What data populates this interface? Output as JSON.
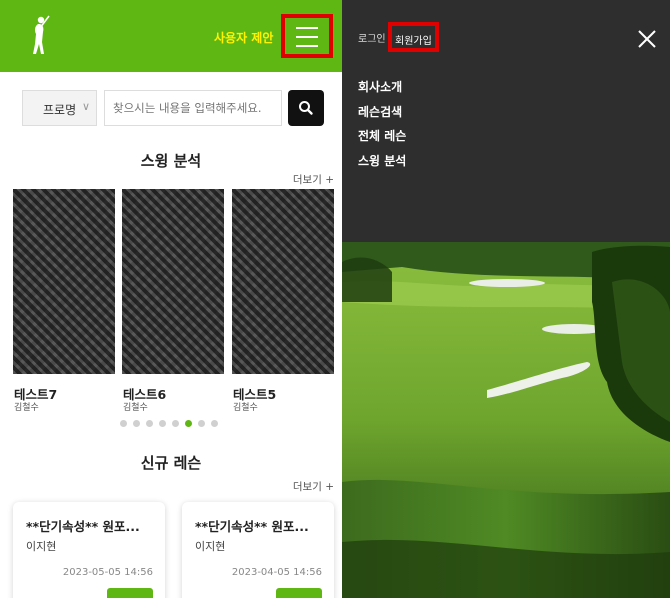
{
  "header": {
    "suggest_label": "사용자 제안",
    "menu_icon": "hamburger-icon",
    "logo_icon": "golfer-logo-icon",
    "brand_color": "#5fb714",
    "suggest_color": "#fff200",
    "highlight_color": "#e00000"
  },
  "search": {
    "select_value": "프로명",
    "placeholder": "찾으시는 내용을 입력해주세요.",
    "button_icon": "search-icon"
  },
  "swing": {
    "title": "스윙 분석",
    "more": "더보기 +",
    "items": [
      {
        "title": "테스트7",
        "author": "김철수"
      },
      {
        "title": "테스트6",
        "author": "김철수"
      },
      {
        "title": "테스트5",
        "author": "김철수"
      }
    ],
    "carousel": {
      "dot_count": 8,
      "active_dot": 6
    }
  },
  "lessons": {
    "title": "신규 레슨",
    "more": "더보기 +",
    "items": [
      {
        "title": "**단기속성** 원포...",
        "author": "이지현",
        "date": "2023-05-05 14:56"
      },
      {
        "title": "**단기속성** 원포...",
        "author": "이지현",
        "date": "2023-04-05 14:56"
      }
    ]
  },
  "drawer": {
    "login": "로그인",
    "signup": "회원가입",
    "close_icon": "close-icon",
    "menu": [
      "회사소개",
      "레슨검색",
      "전체 레슨",
      "스윙 분석"
    ],
    "background_color": "#2e2e2e"
  }
}
